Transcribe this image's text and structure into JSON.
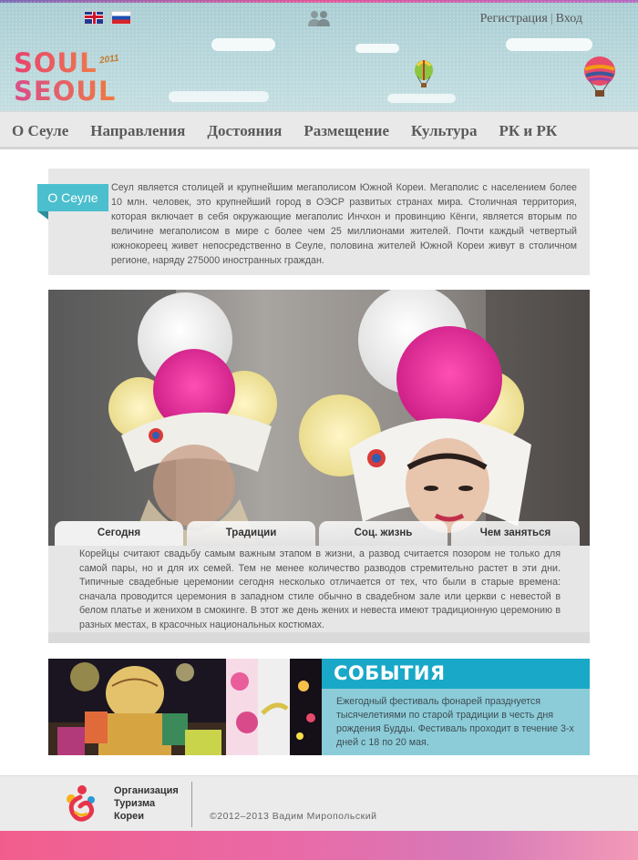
{
  "header": {
    "auth": {
      "register": "Регистрация",
      "login": "Вход"
    },
    "logo": {
      "line1": "SOUL",
      "line2": "SEOUL",
      "year": "2011"
    }
  },
  "nav": {
    "items": [
      "О Сеуле",
      "Направления",
      "Достояния",
      "Размещение",
      "Культура",
      "РК и РК"
    ]
  },
  "about": {
    "tag": "О Сеуле",
    "text": "Сеул является столицей и крупнейшим мегаполисом Южной Кореи. Мегаполис с населением более 10 млн. человек, это крупнейший город в ОЭСР развитых странах мира. Столичная территория, которая включает в себя окружающие мегаполис Инчхон и провинцию Кёнги, является вторым по величине мегаполисом в мире с более чем 25 миллионами жителей. Почти каждый четвертый южнокореец живет непосредственно в Сеуле, половина жителей Южной Кореи живут в столичном регионе, наряду 275000 иностранных граждан."
  },
  "gallery": {
    "tabs": [
      "Сегодня",
      "Традиции",
      "Соц. жизнь",
      "Чем заняться"
    ],
    "active_tab": 0,
    "text": "Корейцы считают свадьбу самым важным этапом в жизни, а развод считается позором не только для самой пары, но и для их семей. Тем не менее количество разводов стремительно растет в эти дни. Типичные свадебные церемонии сегодня несколько отличается от тех, что были в старые времена: сначала проводится церемония в западном стиле обычно в свадебном зале или церкви с невестой в белом платье и женихом в смокинге. В этот же день жених и невеста имеют традиционную церемонию в разных местах, в красочных национальных костюмах."
  },
  "events": {
    "title": "СОБЫТИЯ",
    "text": "Ежегодный фестиваль фонарей празднуется тысячелетиями по старой традиции в честь дня рождения Будды. Фестиваль проходит в течение 3-х дней с 18 по 20 мая."
  },
  "footer": {
    "org_lines": [
      "Организация",
      "Туризма",
      "Кореи"
    ],
    "copyright": "©2012–2013 Вадим Миропольский"
  },
  "colors": {
    "accent": "#4cbfce",
    "events_header": "#19a8c7",
    "events_panel": "#8cccd8",
    "footer_gradient_start": "#f25e8c",
    "footer_gradient_end": "#d77ab8"
  },
  "icons": [
    "flag-uk-icon",
    "flag-ru-icon",
    "people-icon",
    "balloon-icon",
    "kto-logo-icon"
  ]
}
